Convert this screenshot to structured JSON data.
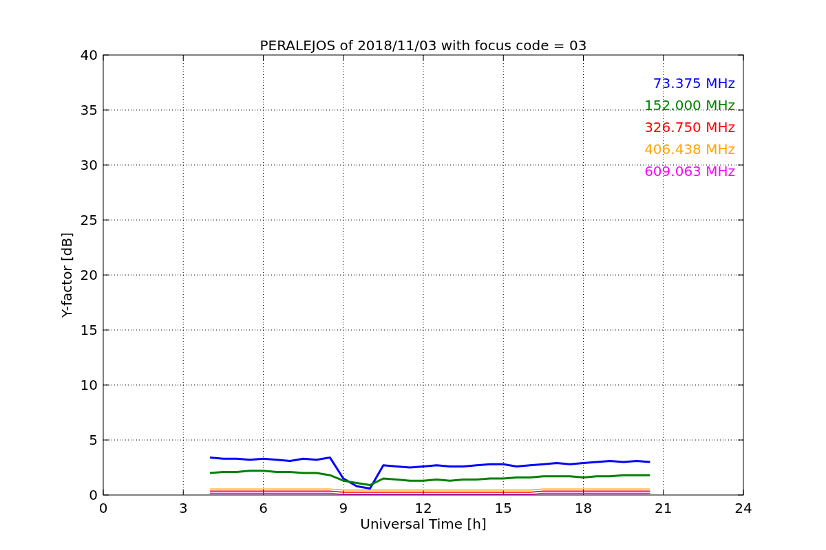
{
  "chart_data": {
    "type": "line",
    "title": "PERALEJOS of 2018/11/03 with focus code = 03",
    "xlabel": "Universal Time [h]",
    "ylabel": "Y-factor [dB]",
    "x": [
      4,
      4.5,
      5,
      5.5,
      6,
      6.5,
      7,
      7.5,
      8,
      8.5,
      9,
      9.5,
      10,
      10.5,
      11,
      11.5,
      12,
      12.5,
      13,
      13.5,
      14,
      14.5,
      15,
      15.5,
      16,
      16.5,
      17,
      17.5,
      18,
      18.5,
      19,
      19.5,
      20,
      20.5
    ],
    "series": [
      {
        "name": "73.375 MHz",
        "color": "#0000ff",
        "values": [
          3.4,
          3.3,
          3.3,
          3.2,
          3.3,
          3.2,
          3.1,
          3.3,
          3.2,
          3.4,
          1.5,
          0.8,
          0.6,
          2.7,
          2.6,
          2.5,
          2.6,
          2.7,
          2.6,
          2.6,
          2.7,
          2.8,
          2.8,
          2.6,
          2.7,
          2.8,
          2.9,
          2.8,
          2.9,
          3.0,
          3.1,
          3.0,
          3.1,
          3.0
        ]
      },
      {
        "name": "152.000 MHz",
        "color": "#008000",
        "values": [
          2.0,
          2.1,
          2.1,
          2.2,
          2.2,
          2.1,
          2.1,
          2.0,
          2.0,
          1.8,
          1.3,
          1.1,
          0.9,
          1.5,
          1.4,
          1.3,
          1.3,
          1.4,
          1.3,
          1.4,
          1.4,
          1.5,
          1.5,
          1.6,
          1.6,
          1.7,
          1.7,
          1.7,
          1.6,
          1.7,
          1.7,
          1.8,
          1.8,
          1.8
        ]
      },
      {
        "name": "326.750 MHz",
        "color": "#ff0000",
        "values": [
          0.35,
          0.35,
          0.35,
          0.35,
          0.35,
          0.35,
          0.35,
          0.35,
          0.35,
          0.35,
          0.25,
          0.25,
          0.25,
          0.25,
          0.25,
          0.25,
          0.25,
          0.25,
          0.25,
          0.25,
          0.25,
          0.25,
          0.25,
          0.25,
          0.25,
          0.35,
          0.35,
          0.35,
          0.35,
          0.35,
          0.35,
          0.35,
          0.35,
          0.35
        ]
      },
      {
        "name": "406.438 MHz",
        "color": "#ffa500",
        "values": [
          0.55,
          0.55,
          0.55,
          0.55,
          0.55,
          0.55,
          0.55,
          0.55,
          0.55,
          0.55,
          0.45,
          0.45,
          0.45,
          0.45,
          0.45,
          0.45,
          0.45,
          0.45,
          0.45,
          0.45,
          0.45,
          0.45,
          0.45,
          0.45,
          0.45,
          0.55,
          0.55,
          0.55,
          0.55,
          0.55,
          0.55,
          0.55,
          0.55,
          0.55
        ]
      },
      {
        "name": "609.063 MHz",
        "color": "#ff00ff",
        "values": [
          0.15,
          0.15,
          0.15,
          0.15,
          0.15,
          0.15,
          0.15,
          0.15,
          0.15,
          0.15,
          0.05,
          0.05,
          0.05,
          0.05,
          0.05,
          0.05,
          0.05,
          0.05,
          0.05,
          0.05,
          0.05,
          0.05,
          0.05,
          0.05,
          0.05,
          0.15,
          0.15,
          0.15,
          0.15,
          0.15,
          0.15,
          0.15,
          0.15,
          0.15
        ]
      }
    ],
    "grid": true,
    "xlim": [
      0,
      24
    ],
    "ylim": [
      0,
      40
    ],
    "xticks": [
      0,
      3,
      6,
      9,
      12,
      15,
      18,
      21,
      24
    ],
    "yticks": [
      0,
      5,
      10,
      15,
      20,
      25,
      30,
      35,
      40
    ]
  }
}
